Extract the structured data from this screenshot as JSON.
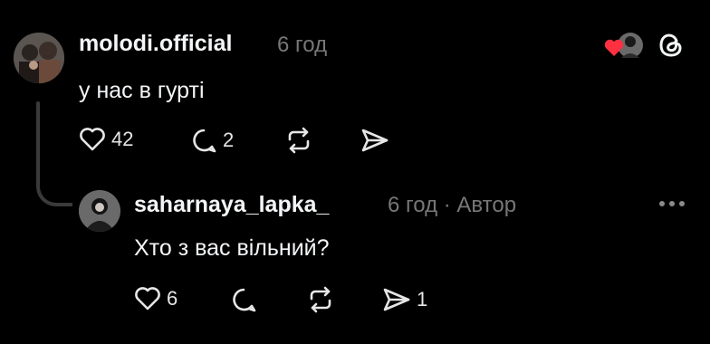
{
  "colors": {
    "background": "#000000",
    "text": "#f3f5f7",
    "muted": "#777777",
    "heart_red": "#ff3040"
  },
  "post": {
    "username": "molodi.official",
    "time": "6 год",
    "text": "у нас в гурті",
    "actions": {
      "like_count": "42",
      "reply_count": "2"
    },
    "icons": [
      "heart-icon",
      "comment-icon",
      "repost-icon",
      "share-icon",
      "liked-by-author-icon",
      "threads-logo-icon"
    ]
  },
  "reply": {
    "username": "saharnaya_lapka_",
    "time": "6 год · Автор",
    "text": "Хто з вас вільний?",
    "actions": {
      "like_count": "6",
      "share_count": "1"
    },
    "icons": [
      "heart-icon",
      "comment-icon",
      "repost-icon",
      "share-icon",
      "more-icon"
    ]
  }
}
